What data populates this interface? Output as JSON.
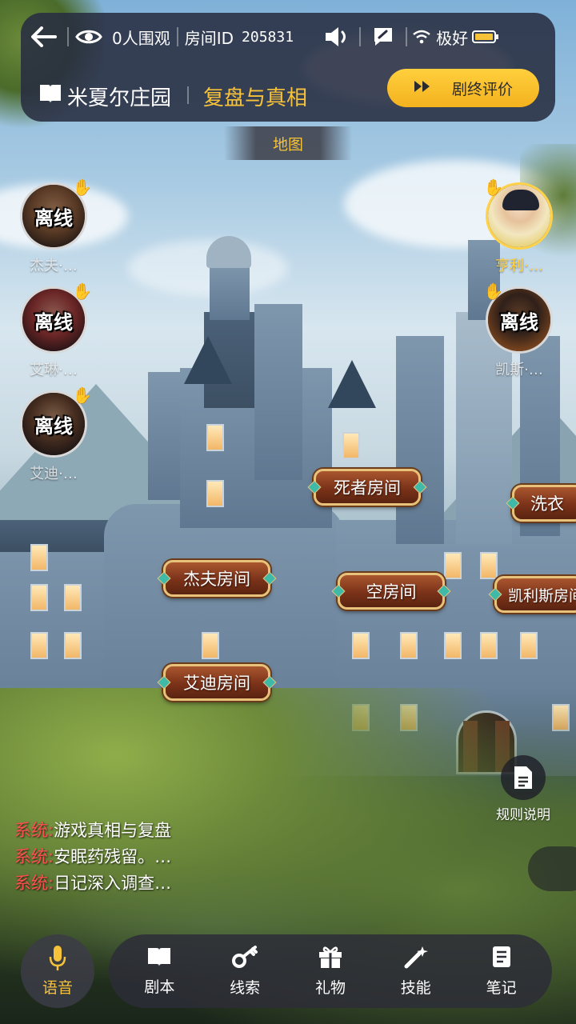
{
  "header": {
    "spectators": "0人围观",
    "room_id_label": "房间ID",
    "room_id": "205831",
    "signal_label": "极好",
    "script_title": "米夏尔庄园",
    "stage_title": "复盘与真相",
    "review_button": "剧终评价"
  },
  "map_tab": "地图",
  "players": {
    "left": [
      {
        "status": "离线",
        "name": "杰夫·…"
      },
      {
        "status": "离线",
        "name": "艾琳·…"
      },
      {
        "status": "离线",
        "name": "艾迪·…"
      }
    ],
    "right": [
      {
        "status": "",
        "name": "亨利·…"
      },
      {
        "status": "离线",
        "name": "凯斯·…"
      }
    ]
  },
  "rooms": {
    "dead_room": "死者房间",
    "laundry": "洗衣",
    "jeff_room": "杰夫房间",
    "empty_room": "空房间",
    "keris_room": "凯利斯房间",
    "eddie_room": "艾迪房间"
  },
  "rules_label": "规则说明",
  "chat": [
    {
      "sender": "系统:",
      "text": "游戏真相与复盘"
    },
    {
      "sender": "系统:",
      "text": "安眠药残留。…"
    },
    {
      "sender": "系统:",
      "text": "日记深入调查…"
    }
  ],
  "bottom_nav": {
    "voice": "语音",
    "items": [
      "剧本",
      "线索",
      "礼物",
      "技能",
      "笔记"
    ]
  },
  "colors": {
    "accent_yellow": "#f6c23a",
    "system_red": "#ff4f4f",
    "room_label_brown": "#7b3219"
  }
}
